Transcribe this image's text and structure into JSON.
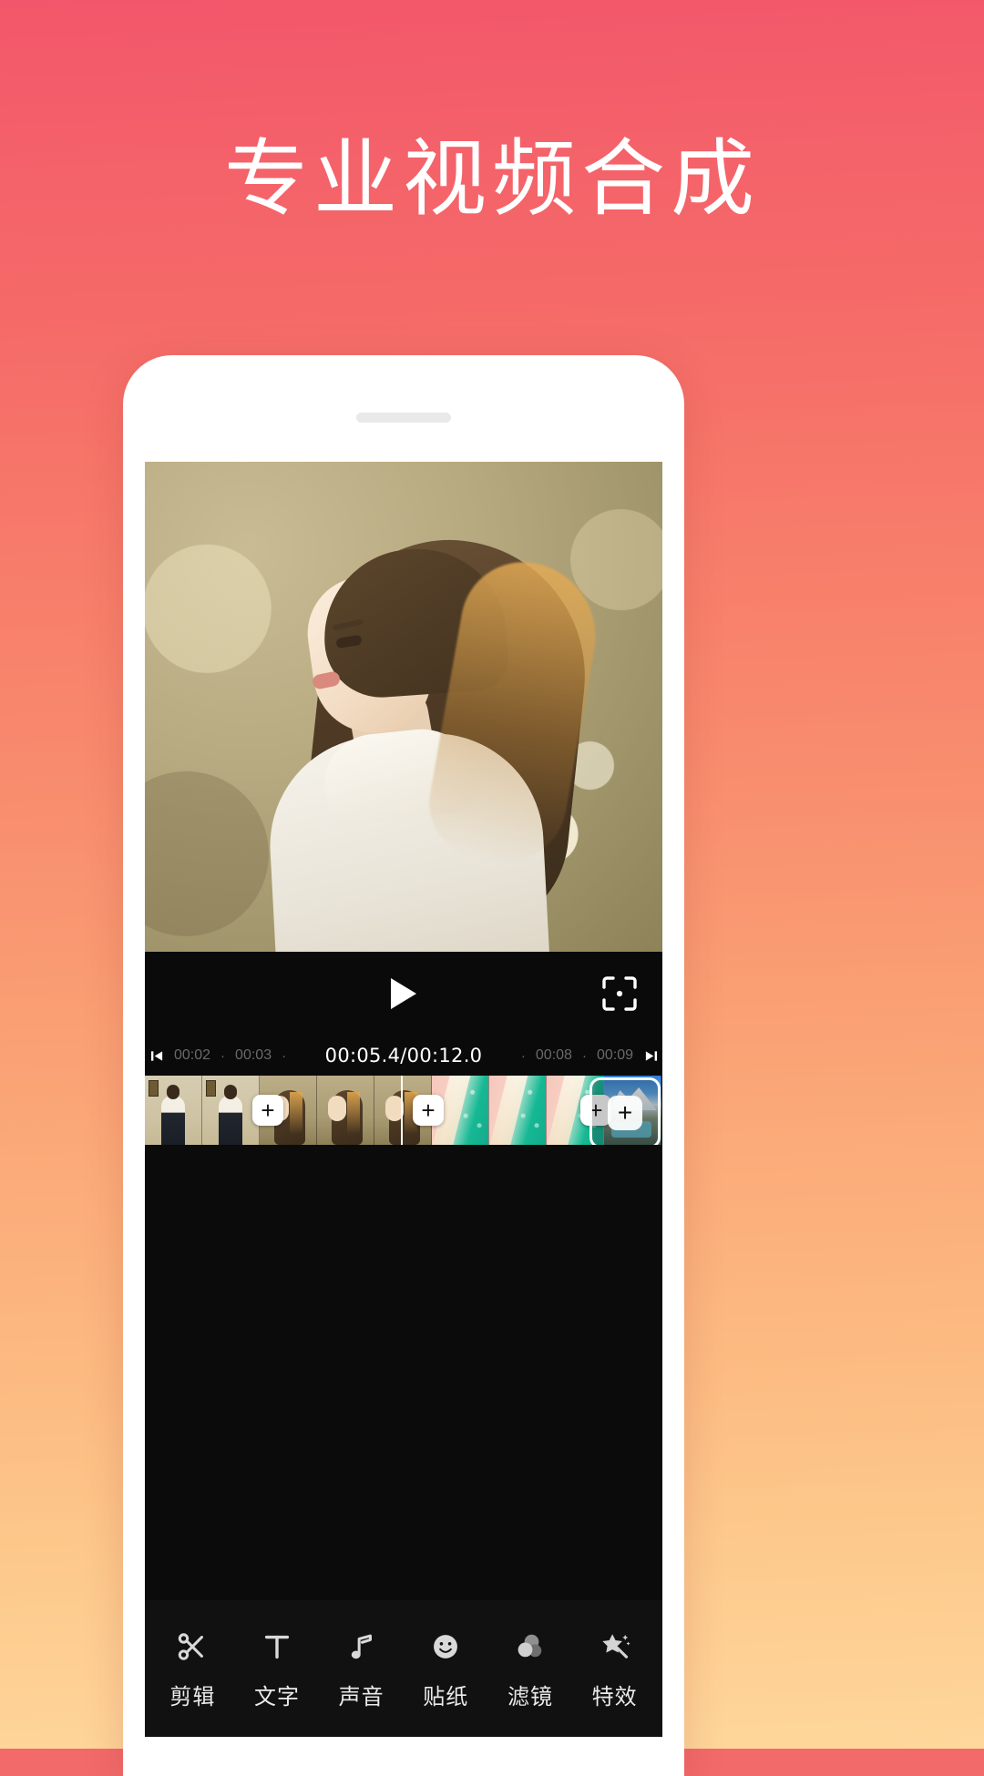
{
  "theme": {
    "bg_top": "#f2566a",
    "bg_bottom": "#fed79c",
    "panel_bg": "#0a0a0a",
    "toolbar_bg": "#111111",
    "accent_white": "#ffffff",
    "muted_text": "#6a6a6a"
  },
  "headline": {
    "text": "专业视频合成"
  },
  "player": {
    "play_button": "play-triangle",
    "crop_button": "fullscreen-frame",
    "prev_label": "◀",
    "next_label": "▶"
  },
  "timeline": {
    "left_ticks": [
      "00:02",
      "00:03"
    ],
    "right_ticks": [
      "00:08",
      "00:09"
    ],
    "dot": "·",
    "current_time": "00:05.4",
    "separator": "/",
    "total_time": "00:12.0",
    "current_over_total": "00:05.4/00:12.0"
  },
  "filmstrip": {
    "add_symbol": "+",
    "clips": [
      {
        "name": "clip-girl-vest",
        "frames": 2,
        "style": "fA"
      },
      {
        "name": "clip-portrait-profile",
        "frames": 3,
        "style": "fB"
      },
      {
        "name": "clip-beach-aerial",
        "frames": 3,
        "style": "fC"
      },
      {
        "name": "clip-mountain-lake",
        "frames": 1,
        "style": "fD"
      }
    ]
  },
  "toolbar": {
    "items": [
      {
        "label": "剪辑",
        "icon": "scissors-icon"
      },
      {
        "label": "文字",
        "icon": "text-t-icon"
      },
      {
        "label": "声音",
        "icon": "music-note-icon"
      },
      {
        "label": "贴纸",
        "icon": "smiley-icon"
      },
      {
        "label": "滤镜",
        "icon": "filter-circles-icon"
      },
      {
        "label": "特效",
        "icon": "magic-wand-star-icon"
      }
    ]
  }
}
